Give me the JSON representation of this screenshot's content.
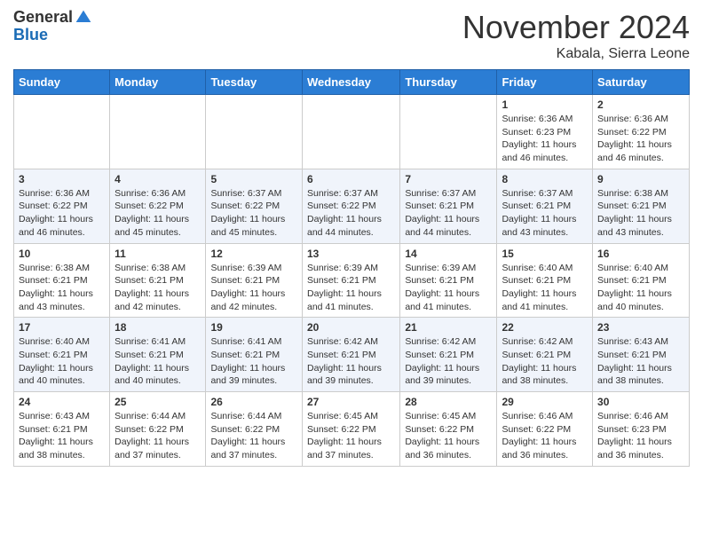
{
  "header": {
    "logo_line1": "General",
    "logo_line2": "Blue",
    "month": "November 2024",
    "location": "Kabala, Sierra Leone"
  },
  "weekdays": [
    "Sunday",
    "Monday",
    "Tuesday",
    "Wednesday",
    "Thursday",
    "Friday",
    "Saturday"
  ],
  "weeks": [
    [
      {
        "day": "",
        "info": ""
      },
      {
        "day": "",
        "info": ""
      },
      {
        "day": "",
        "info": ""
      },
      {
        "day": "",
        "info": ""
      },
      {
        "day": "",
        "info": ""
      },
      {
        "day": "1",
        "info": "Sunrise: 6:36 AM\nSunset: 6:23 PM\nDaylight: 11 hours\nand 46 minutes."
      },
      {
        "day": "2",
        "info": "Sunrise: 6:36 AM\nSunset: 6:22 PM\nDaylight: 11 hours\nand 46 minutes."
      }
    ],
    [
      {
        "day": "3",
        "info": "Sunrise: 6:36 AM\nSunset: 6:22 PM\nDaylight: 11 hours\nand 46 minutes."
      },
      {
        "day": "4",
        "info": "Sunrise: 6:36 AM\nSunset: 6:22 PM\nDaylight: 11 hours\nand 45 minutes."
      },
      {
        "day": "5",
        "info": "Sunrise: 6:37 AM\nSunset: 6:22 PM\nDaylight: 11 hours\nand 45 minutes."
      },
      {
        "day": "6",
        "info": "Sunrise: 6:37 AM\nSunset: 6:22 PM\nDaylight: 11 hours\nand 44 minutes."
      },
      {
        "day": "7",
        "info": "Sunrise: 6:37 AM\nSunset: 6:21 PM\nDaylight: 11 hours\nand 44 minutes."
      },
      {
        "day": "8",
        "info": "Sunrise: 6:37 AM\nSunset: 6:21 PM\nDaylight: 11 hours\nand 43 minutes."
      },
      {
        "day": "9",
        "info": "Sunrise: 6:38 AM\nSunset: 6:21 PM\nDaylight: 11 hours\nand 43 minutes."
      }
    ],
    [
      {
        "day": "10",
        "info": "Sunrise: 6:38 AM\nSunset: 6:21 PM\nDaylight: 11 hours\nand 43 minutes."
      },
      {
        "day": "11",
        "info": "Sunrise: 6:38 AM\nSunset: 6:21 PM\nDaylight: 11 hours\nand 42 minutes."
      },
      {
        "day": "12",
        "info": "Sunrise: 6:39 AM\nSunset: 6:21 PM\nDaylight: 11 hours\nand 42 minutes."
      },
      {
        "day": "13",
        "info": "Sunrise: 6:39 AM\nSunset: 6:21 PM\nDaylight: 11 hours\nand 41 minutes."
      },
      {
        "day": "14",
        "info": "Sunrise: 6:39 AM\nSunset: 6:21 PM\nDaylight: 11 hours\nand 41 minutes."
      },
      {
        "day": "15",
        "info": "Sunrise: 6:40 AM\nSunset: 6:21 PM\nDaylight: 11 hours\nand 41 minutes."
      },
      {
        "day": "16",
        "info": "Sunrise: 6:40 AM\nSunset: 6:21 PM\nDaylight: 11 hours\nand 40 minutes."
      }
    ],
    [
      {
        "day": "17",
        "info": "Sunrise: 6:40 AM\nSunset: 6:21 PM\nDaylight: 11 hours\nand 40 minutes."
      },
      {
        "day": "18",
        "info": "Sunrise: 6:41 AM\nSunset: 6:21 PM\nDaylight: 11 hours\nand 40 minutes."
      },
      {
        "day": "19",
        "info": "Sunrise: 6:41 AM\nSunset: 6:21 PM\nDaylight: 11 hours\nand 39 minutes."
      },
      {
        "day": "20",
        "info": "Sunrise: 6:42 AM\nSunset: 6:21 PM\nDaylight: 11 hours\nand 39 minutes."
      },
      {
        "day": "21",
        "info": "Sunrise: 6:42 AM\nSunset: 6:21 PM\nDaylight: 11 hours\nand 39 minutes."
      },
      {
        "day": "22",
        "info": "Sunrise: 6:42 AM\nSunset: 6:21 PM\nDaylight: 11 hours\nand 38 minutes."
      },
      {
        "day": "23",
        "info": "Sunrise: 6:43 AM\nSunset: 6:21 PM\nDaylight: 11 hours\nand 38 minutes."
      }
    ],
    [
      {
        "day": "24",
        "info": "Sunrise: 6:43 AM\nSunset: 6:21 PM\nDaylight: 11 hours\nand 38 minutes."
      },
      {
        "day": "25",
        "info": "Sunrise: 6:44 AM\nSunset: 6:22 PM\nDaylight: 11 hours\nand 37 minutes."
      },
      {
        "day": "26",
        "info": "Sunrise: 6:44 AM\nSunset: 6:22 PM\nDaylight: 11 hours\nand 37 minutes."
      },
      {
        "day": "27",
        "info": "Sunrise: 6:45 AM\nSunset: 6:22 PM\nDaylight: 11 hours\nand 37 minutes."
      },
      {
        "day": "28",
        "info": "Sunrise: 6:45 AM\nSunset: 6:22 PM\nDaylight: 11 hours\nand 36 minutes."
      },
      {
        "day": "29",
        "info": "Sunrise: 6:46 AM\nSunset: 6:22 PM\nDaylight: 11 hours\nand 36 minutes."
      },
      {
        "day": "30",
        "info": "Sunrise: 6:46 AM\nSunset: 6:23 PM\nDaylight: 11 hours\nand 36 minutes."
      }
    ]
  ]
}
